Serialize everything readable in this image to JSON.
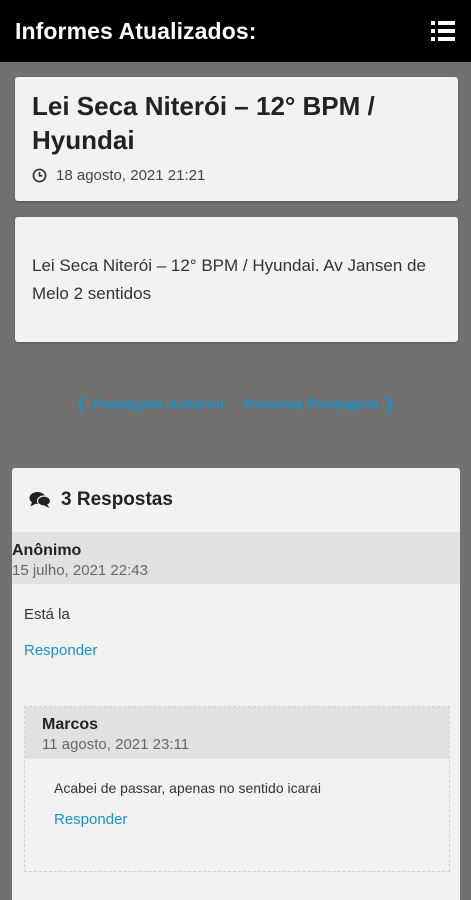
{
  "appbar": {
    "title": "Informes Atualizados:",
    "menu_icon": "list-menu-icon"
  },
  "post": {
    "title": "Lei Seca Niterói – 12° BPM / Hyundai",
    "date": "18 agosto, 2021 21:21",
    "body": "Lei Seca Niterói – 12° BPM / Hyundai. Av Jansen de Melo 2 sentidos"
  },
  "nav": {
    "prev": "❮ Postagem Anterior",
    "next": "Próxima Postagem ❯"
  },
  "comments": {
    "title": "3 Respostas",
    "items": [
      {
        "author": "Anônimo",
        "date": "15 julho, 2021 22:43",
        "text": "Está la",
        "reply_label": "Responder"
      },
      {
        "author": "Marcos",
        "date": "11 agosto, 2021 23:11",
        "text": "Acabei de passar, apenas no sentido icarai",
        "reply_label": "Responder"
      }
    ]
  },
  "colors": {
    "accent": "#1d90c8",
    "appbar": "#000000",
    "background": "#737170",
    "card": "#f2f2f2"
  }
}
